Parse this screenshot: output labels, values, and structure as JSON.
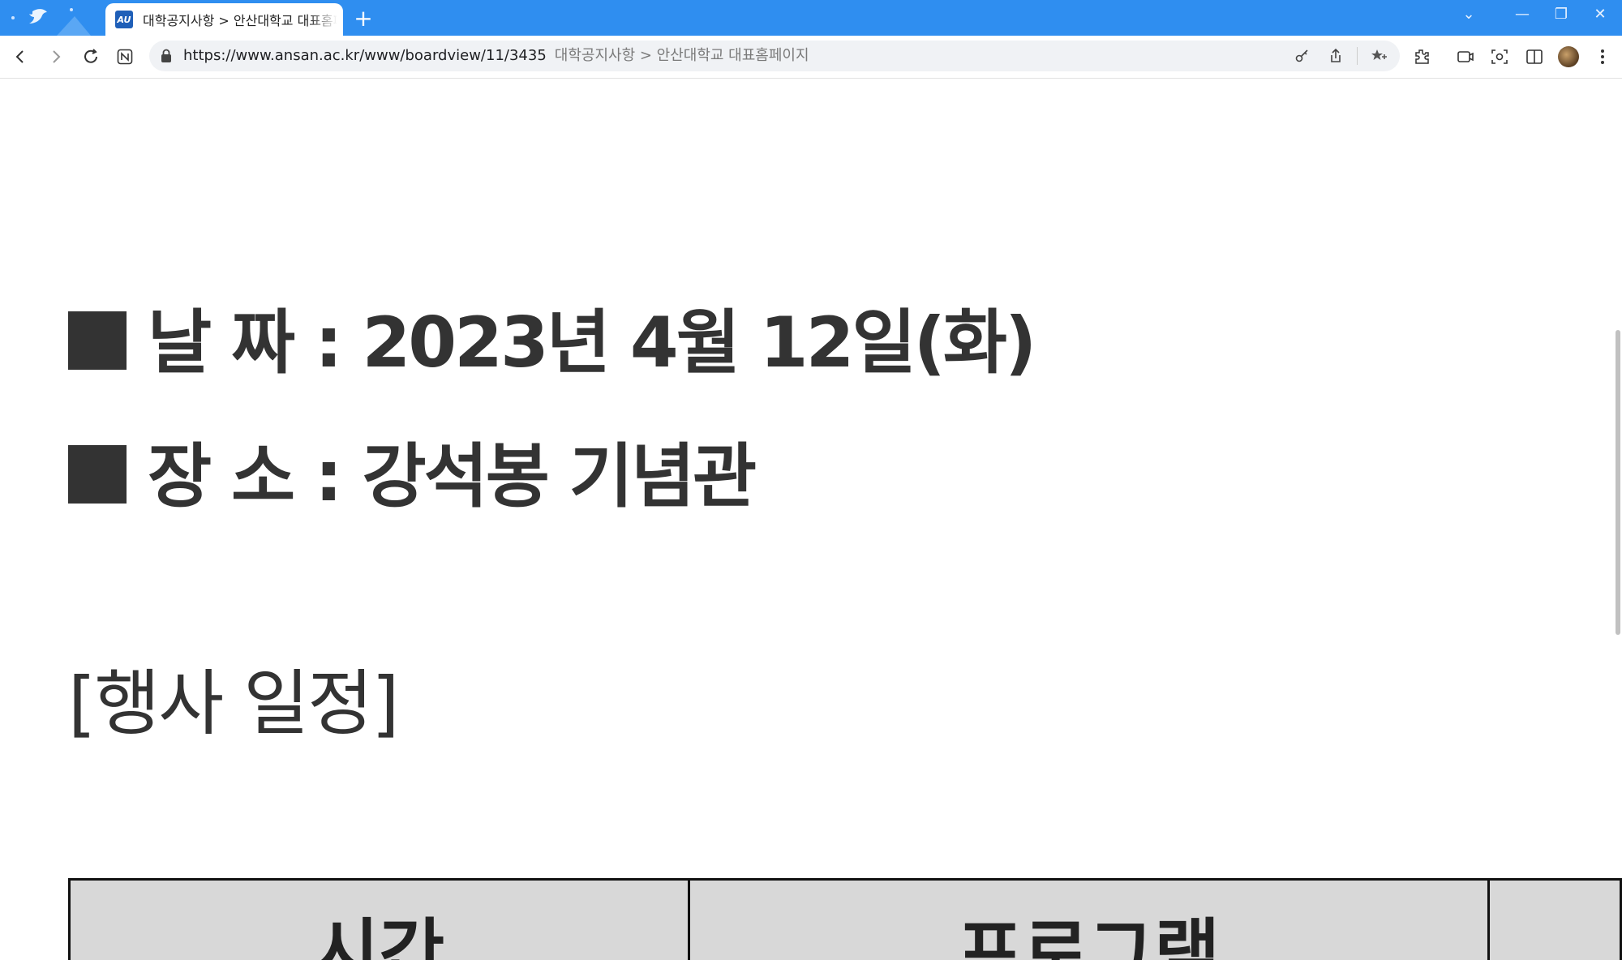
{
  "browser": {
    "tab": {
      "favicon_text": "AU",
      "title": "대학공지사항 > 안산대학교 대표홈페이지"
    },
    "new_tab_label": "+",
    "window_controls": [
      "⌄",
      "—",
      "❐",
      "✕"
    ],
    "address_bar": {
      "url": "https://www.ansan.ac.kr/www/boardview/11/3435",
      "page_title": "대학공지사항 > 안산대학교 대표홈페이지"
    },
    "icons": {
      "back": "back-arrow-icon",
      "forward": "forward-arrow-icon",
      "reload": "reload-icon",
      "notion": "notion-icon",
      "lock": "lock-icon",
      "key": "key-icon",
      "share": "share-icon",
      "favorites": "favorites-icon",
      "extensions": "extensions-icon",
      "record": "record-icon",
      "screenshot": "screenshot-icon",
      "split_view": "split-view-icon",
      "menu": "more-menu-icon"
    },
    "accent_color": "#2f8ef0"
  },
  "page": {
    "date_line": "날 짜 : 2023년 4월 12일(화)",
    "place_line": "장 소 : 강석봉 기념관",
    "schedule_heading": "[행사 일정]",
    "table_headers": [
      "시간",
      "프로그램",
      ""
    ]
  }
}
